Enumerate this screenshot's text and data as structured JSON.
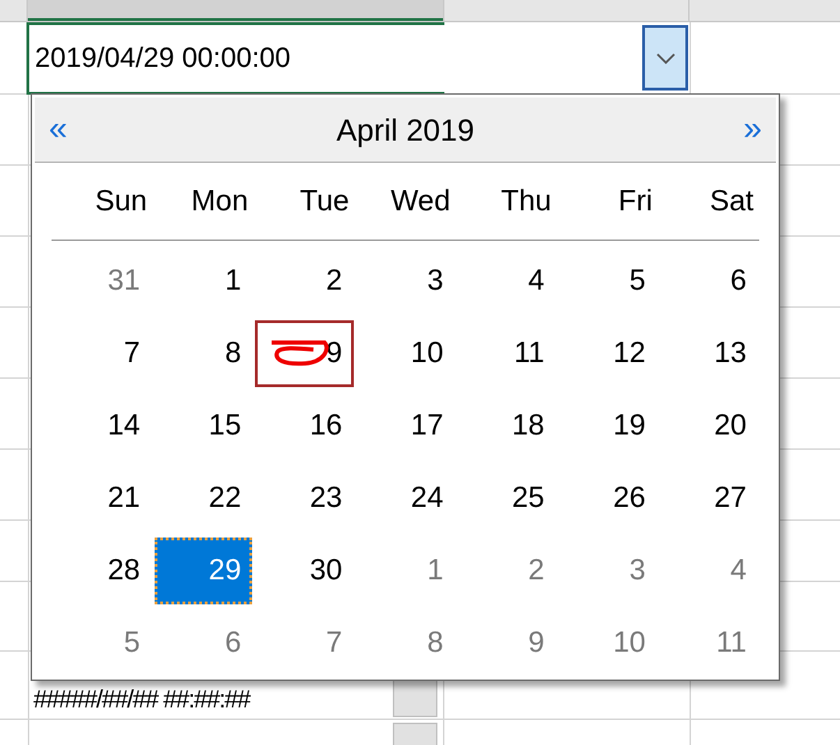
{
  "cell": {
    "value": "2019/04/29 00:00:00"
  },
  "calendar": {
    "month_title": "April 2019",
    "prev": "«",
    "next": "»",
    "weekdays": [
      "Sun",
      "Mon",
      "Tue",
      "Wed",
      "Thu",
      "Fri",
      "Sat"
    ],
    "weeks": [
      [
        {
          "label": "31",
          "kind": "other",
          "selected": false,
          "today": false
        },
        {
          "label": "1",
          "kind": "current",
          "selected": false,
          "today": false
        },
        {
          "label": "2",
          "kind": "current",
          "selected": false,
          "today": false
        },
        {
          "label": "3",
          "kind": "current",
          "selected": false,
          "today": false
        },
        {
          "label": "4",
          "kind": "current",
          "selected": false,
          "today": false
        },
        {
          "label": "5",
          "kind": "current",
          "selected": false,
          "today": false
        },
        {
          "label": "6",
          "kind": "current",
          "selected": false,
          "today": false
        }
      ],
      [
        {
          "label": "7",
          "kind": "current",
          "selected": false,
          "today": false
        },
        {
          "label": "8",
          "kind": "current",
          "selected": false,
          "today": false
        },
        {
          "label": "9",
          "kind": "current",
          "selected": false,
          "today": true
        },
        {
          "label": "10",
          "kind": "current",
          "selected": false,
          "today": false
        },
        {
          "label": "11",
          "kind": "current",
          "selected": false,
          "today": false
        },
        {
          "label": "12",
          "kind": "current",
          "selected": false,
          "today": false
        },
        {
          "label": "13",
          "kind": "current",
          "selected": false,
          "today": false
        }
      ],
      [
        {
          "label": "14",
          "kind": "current",
          "selected": false,
          "today": false
        },
        {
          "label": "15",
          "kind": "current",
          "selected": false,
          "today": false
        },
        {
          "label": "16",
          "kind": "current",
          "selected": false,
          "today": false
        },
        {
          "label": "17",
          "kind": "current",
          "selected": false,
          "today": false
        },
        {
          "label": "18",
          "kind": "current",
          "selected": false,
          "today": false
        },
        {
          "label": "19",
          "kind": "current",
          "selected": false,
          "today": false
        },
        {
          "label": "20",
          "kind": "current",
          "selected": false,
          "today": false
        }
      ],
      [
        {
          "label": "21",
          "kind": "current",
          "selected": false,
          "today": false
        },
        {
          "label": "22",
          "kind": "current",
          "selected": false,
          "today": false
        },
        {
          "label": "23",
          "kind": "current",
          "selected": false,
          "today": false
        },
        {
          "label": "24",
          "kind": "current",
          "selected": false,
          "today": false
        },
        {
          "label": "25",
          "kind": "current",
          "selected": false,
          "today": false
        },
        {
          "label": "26",
          "kind": "current",
          "selected": false,
          "today": false
        },
        {
          "label": "27",
          "kind": "current",
          "selected": false,
          "today": false
        }
      ],
      [
        {
          "label": "28",
          "kind": "current",
          "selected": false,
          "today": false
        },
        {
          "label": "29",
          "kind": "current",
          "selected": true,
          "today": false
        },
        {
          "label": "30",
          "kind": "current",
          "selected": false,
          "today": false
        },
        {
          "label": "1",
          "kind": "other",
          "selected": false,
          "today": false
        },
        {
          "label": "2",
          "kind": "other",
          "selected": false,
          "today": false
        },
        {
          "label": "3",
          "kind": "other",
          "selected": false,
          "today": false
        },
        {
          "label": "4",
          "kind": "other",
          "selected": false,
          "today": false
        }
      ],
      [
        {
          "label": "5",
          "kind": "other",
          "selected": false,
          "today": false
        },
        {
          "label": "6",
          "kind": "other",
          "selected": false,
          "today": false
        },
        {
          "label": "7",
          "kind": "other",
          "selected": false,
          "today": false
        },
        {
          "label": "8",
          "kind": "other",
          "selected": false,
          "today": false
        },
        {
          "label": "9",
          "kind": "other",
          "selected": false,
          "today": false
        },
        {
          "label": "10",
          "kind": "other",
          "selected": false,
          "today": false
        },
        {
          "label": "11",
          "kind": "other",
          "selected": false,
          "today": false
        }
      ]
    ]
  },
  "lower_cell": {
    "value": "#####/##/## ##:##:##"
  }
}
